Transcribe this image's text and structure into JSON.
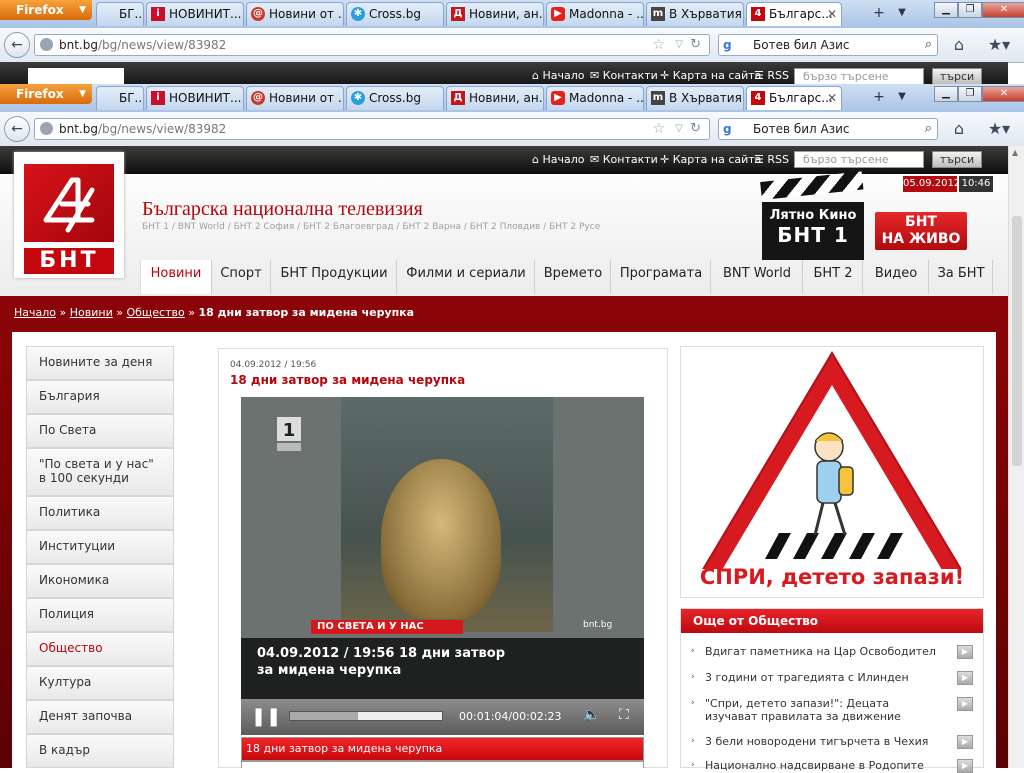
{
  "browser": {
    "firefox_label": "Firefox",
    "tabs": [
      {
        "label": "БГ..."
      },
      {
        "label": "НОВИНИТ..."
      },
      {
        "label": "Новини от ..."
      },
      {
        "label": "Cross.bg"
      },
      {
        "label": "Новини, ан..."
      },
      {
        "label": "Madonna - ..."
      },
      {
        "label": "В Хърватия ..."
      },
      {
        "label": "Българс..."
      }
    ],
    "url_host": "bnt.bg",
    "url_path": "/bg/news/view/83982",
    "search_value": "Ботев бил Азис"
  },
  "site": {
    "top_links": [
      "Начало",
      "Контакти",
      "Карта на сайта",
      "RSS"
    ],
    "quick_search_placeholder": "бързо търсене",
    "search_button": "търси",
    "logo_text": "БНТ",
    "title": "Българска национална телевизия",
    "channels": "БНТ 1 / BNT World / БНТ 2 София / БНТ 2 Благоевград / БНТ 2 Варна / БНТ 2 Пловдив / БНТ 2 Русе",
    "date": "05.09.2012",
    "time": "10:46",
    "promo_line1": "Лятно Кино",
    "promo_line2": "БНТ 1",
    "live_line1": "БНТ",
    "live_line2": "НА ЖИВО",
    "nav": [
      "Новини",
      "Спорт",
      "БНТ Продукции",
      "Филми и сериали",
      "Времето",
      "Програмата",
      "BNT World",
      "БНТ 2",
      "Видео",
      "За БНТ"
    ]
  },
  "breadcrumb": {
    "items": [
      "Начало",
      "Новини",
      "Общество"
    ],
    "current": "18 дни затвор за мидена черупка"
  },
  "sidebar": {
    "items": [
      "Новините за деня",
      "България",
      "По Света",
      "\"По света и у нас\" в 100 секунди",
      "Политика",
      "Институции",
      "Икономика",
      "Полиция",
      "Общество",
      "Култура",
      "Денят започва",
      "В кадър"
    ],
    "current": "Общество"
  },
  "article": {
    "date": "04.09.2012 / 19:56",
    "title": "18 дни затвор за мидена черупка",
    "video_tag": "ПО СВЕТА И У НАС",
    "video_source": "bnt.bg",
    "video_caption": "04.09.2012 / 19:56  18 дни затвор за мидена черупка",
    "player_time": "00:01:04/00:02:23",
    "progress": 0.45,
    "playlist_item": "18 дни затвор за мидена черупка"
  },
  "banner": {
    "slogan": "СПРИ, детето запази!"
  },
  "more": {
    "title": "Още от Общество",
    "items": [
      "Вдигат паметника на Цар Освободител",
      "3 години от трагедията с Илинден",
      "\"Спри, детето запази!\": Децата изучават правилата за движение",
      "3 бели новородени тигърчета в Чехия",
      "Национално надсвирване в Родопите"
    ]
  },
  "colors": {
    "brand_red": "#b4060d",
    "dark_red": "#5a0204"
  }
}
